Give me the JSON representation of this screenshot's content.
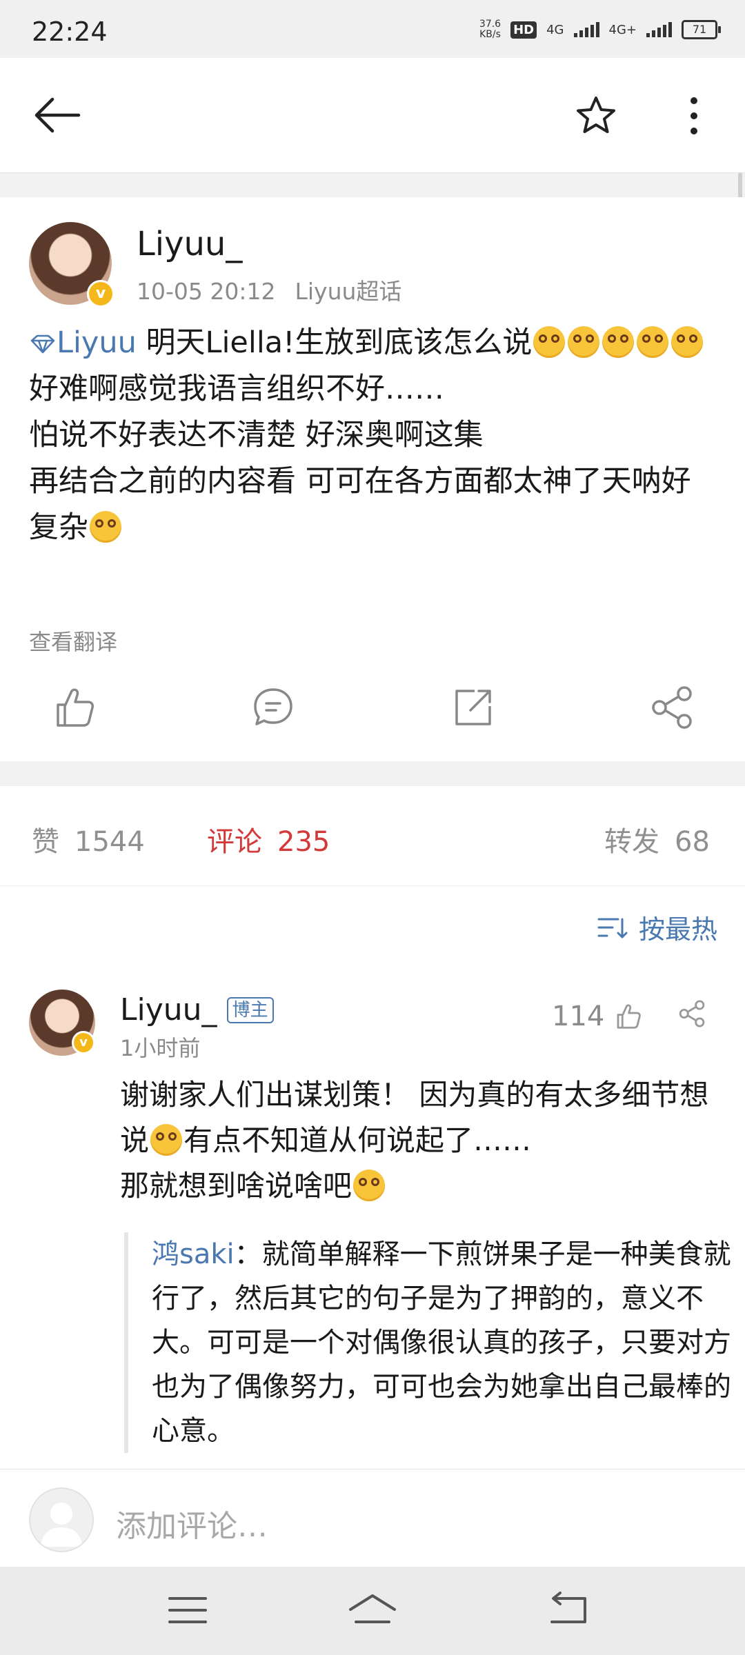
{
  "status_bar": {
    "time": "22:24",
    "speed_value": "37.6",
    "speed_unit": "KB/s",
    "hd_label": "HD",
    "network1": "4G",
    "network2": "4G+",
    "battery": "71"
  },
  "top_bar": {
    "back_icon": "arrow-left-icon",
    "favorite_icon": "star-icon",
    "more_icon": "more-vertical-icon"
  },
  "post": {
    "username": "Liyuu_",
    "timestamp": "10-05 20:12",
    "source": "Liyuu超话",
    "topic": "Liyuu",
    "line1": " 明天Liella!生放到底该怎么说",
    "line2": "好难啊感觉我语言组织不好……",
    "line3": "怕说不好表达不清楚 好深奥啊这集",
    "line4": "再结合之前的内容看 可可在各方面都太神了天呐好复杂",
    "translate_label": "查看翻译",
    "actions": [
      "like-icon",
      "comment-icon",
      "repost-icon",
      "share-icon"
    ]
  },
  "stats": {
    "likes_label": "赞",
    "likes_count": "1544",
    "comments_label": "评论",
    "comments_count": "235",
    "reposts_label": "转发",
    "reposts_count": "68"
  },
  "comments": {
    "sort_label": "按最热",
    "items": [
      {
        "username": "Liyuu_",
        "badge": "博主",
        "time": "1小时前",
        "likes": "114",
        "text_a": "谢谢家人们出谋划策！  因为真的有太多细节想说",
        "text_b": "有点不知道从何说起了……",
        "text_c": "那就想到啥说啥吧",
        "reply_user": "鸿saki",
        "reply_text": "：就简单解释一下煎饼果子是一种美食就行了，然后其它的句子是为了押韵的，意义不大。可可是一个对偶像很认真的孩子，只要对方也为了偶像努力，可可也会为她拿出自己最棒的心意。"
      }
    ]
  },
  "input_bar": {
    "placeholder": "添加评论…"
  },
  "nav_bar": {
    "icons": [
      "menu-icon",
      "home-icon",
      "back-icon"
    ]
  },
  "colors": {
    "link_blue": "#4a78b0",
    "comment_red": "#d23a3a",
    "verified_gold": "#f5b81b"
  }
}
